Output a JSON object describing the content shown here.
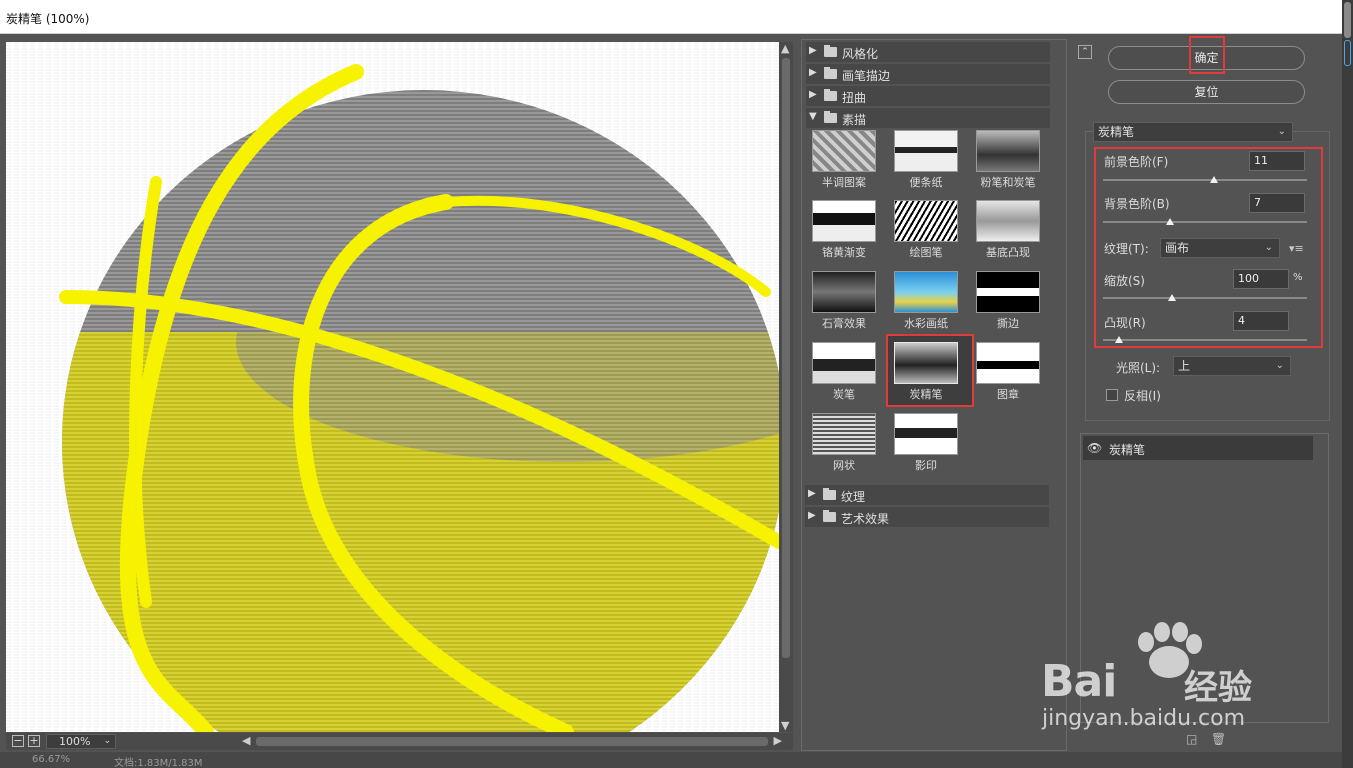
{
  "window": {
    "title": "炭精笔 (100%)"
  },
  "preview": {
    "zoom": "100%"
  },
  "status": {
    "zoom": "66.67%",
    "doc": "文档:1.83M/1.83M"
  },
  "gallery": {
    "categories_top": [
      {
        "label": "风格化",
        "expanded": false
      },
      {
        "label": "画笔描边",
        "expanded": false
      },
      {
        "label": "扭曲",
        "expanded": false
      },
      {
        "label": "素描",
        "expanded": true
      }
    ],
    "sketch_filters": [
      {
        "label": "半调图案"
      },
      {
        "label": "便条纸"
      },
      {
        "label": "粉笔和炭笔"
      },
      {
        "label": "铬黄渐变"
      },
      {
        "label": "绘图笔"
      },
      {
        "label": "基底凸现"
      },
      {
        "label": "石膏效果"
      },
      {
        "label": "水彩画纸"
      },
      {
        "label": "撕边"
      },
      {
        "label": "炭笔"
      },
      {
        "label": "炭精笔",
        "selected": true
      },
      {
        "label": "图章"
      },
      {
        "label": "网状"
      },
      {
        "label": "影印"
      }
    ],
    "categories_bottom": [
      {
        "label": "纹理",
        "expanded": false
      },
      {
        "label": "艺术效果",
        "expanded": false
      }
    ]
  },
  "settings": {
    "ok_label": "确定",
    "reset_label": "复位",
    "filter_select": "炭精笔",
    "foreground_label": "前景色阶(F)",
    "foreground_value": "11",
    "foreground_level": 0.545,
    "background_label": "背景色阶(B)",
    "background_value": "7",
    "background_level": 0.33,
    "texture_label": "纹理(T):",
    "texture_value": "画布",
    "scale_label": "缩放(S)",
    "scale_value": "100",
    "scale_unit": "%",
    "scale_level": 0.34,
    "relief_label": "凸现(R)",
    "relief_value": "4",
    "relief_level": 0.08,
    "light_label": "光照(L):",
    "light_value": "上",
    "invert_label": "反相(I)",
    "invert_checked": false
  },
  "layers": [
    {
      "label": "炭精笔",
      "visible": true
    }
  ],
  "watermark": {
    "brand": "Bai",
    "brand2": "经验",
    "url": "jingyan.baidu.com"
  },
  "colors": {
    "highlight": "#e03b3b",
    "ball": "#f7f200",
    "panel": "#535353"
  }
}
